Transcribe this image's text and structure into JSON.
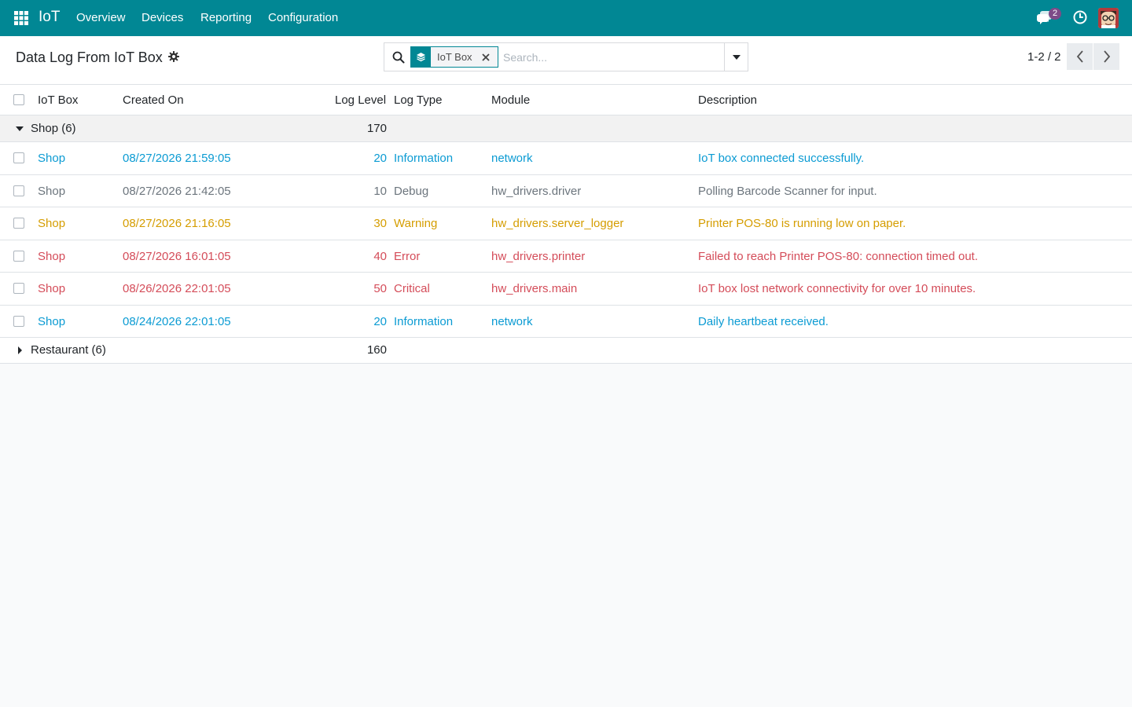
{
  "navbar": {
    "brand": "IoT",
    "menu": [
      "Overview",
      "Devices",
      "Reporting",
      "Configuration"
    ],
    "chat_badge": "2",
    "color": "#018794"
  },
  "control_panel": {
    "title": "Data Log From IoT Box",
    "search": {
      "facet_label": "IoT Box",
      "placeholder": "Search..."
    },
    "pager": "1-2 / 2"
  },
  "list": {
    "columns": [
      "IoT Box",
      "Created On",
      "Log Level",
      "Log Type",
      "Module",
      "Description"
    ],
    "groups": [
      {
        "label": "Shop (6)",
        "expanded": true,
        "sum": "170",
        "rows": [
          {
            "iot_box": "Shop",
            "created_on": "08/27/2026 21:59:05",
            "log_level": "20",
            "log_type": "Information",
            "module": "network",
            "description": "IoT box connected successfully.",
            "color": "#0b9bd3"
          },
          {
            "iot_box": "Shop",
            "created_on": "08/27/2026 21:42:05",
            "log_level": "10",
            "log_type": "Debug",
            "module": "hw_drivers.driver",
            "description": "Polling Barcode Scanner for input.",
            "color": "#6c757d"
          },
          {
            "iot_box": "Shop",
            "created_on": "08/27/2026 21:16:05",
            "log_level": "30",
            "log_type": "Warning",
            "module": "hw_drivers.server_logger",
            "description": "Printer POS-80 is running low on paper.",
            "color": "#d59d00"
          },
          {
            "iot_box": "Shop",
            "created_on": "08/27/2026 16:01:05",
            "log_level": "40",
            "log_type": "Error",
            "module": "hw_drivers.printer",
            "description": "Failed to reach Printer POS-80: connection timed out.",
            "color": "#d44c59"
          },
          {
            "iot_box": "Shop",
            "created_on": "08/26/2026 22:01:05",
            "log_level": "50",
            "log_type": "Critical",
            "module": "hw_drivers.main",
            "description": "IoT box lost network connectivity for over 10 minutes.",
            "color": "#d44c59"
          },
          {
            "iot_box": "Shop",
            "created_on": "08/24/2026 22:01:05",
            "log_level": "20",
            "log_type": "Information",
            "module": "network",
            "description": "Daily heartbeat received.",
            "color": "#0b9bd3"
          }
        ]
      },
      {
        "label": "Restaurant (6)",
        "expanded": false,
        "sum": "160",
        "rows": []
      }
    ]
  }
}
